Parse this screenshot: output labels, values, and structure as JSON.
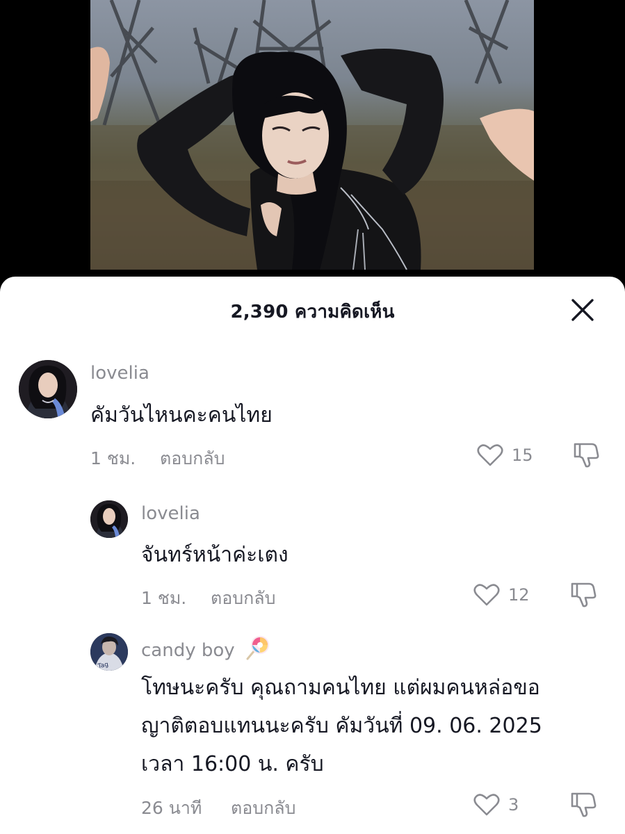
{
  "video": {
    "description": "music video still"
  },
  "sheet": {
    "title": "2,390 ความคิดเห็น"
  },
  "comments": [
    {
      "username": "lovelia",
      "text": "คัมวันไหนคะคนไทย",
      "time": "1 ชม.",
      "reply_label": "ตอบกลับ",
      "likes": "15"
    },
    {
      "username": "lovelia",
      "text": "จันทร์หน้าค่ะเตง",
      "time": "1 ชม.",
      "reply_label": "ตอบกลับ",
      "likes": "12"
    },
    {
      "username": "candy boy",
      "username_emoji": "lollipop-emoji",
      "text_lines": [
        "โทษนะครับ คุณถามคนไทย แต่ผมคนหล่อขอ",
        "ญาติตอบแทนนะครับ คัมวันที่ 09. 06. 2025",
        "เวลา 16:00 น. ครับ"
      ],
      "time": "26 นาที",
      "reply_label": "ตอบกลับ",
      "likes": "3"
    }
  ],
  "icons": {
    "close": "close-icon",
    "like": "heart-outline-icon",
    "dislike": "thumbs-down-icon"
  },
  "colors": {
    "sheet_bg": "#ffffff",
    "text_primary": "#161823",
    "text_secondary": "#8a8b91",
    "backdrop": "#000000"
  }
}
